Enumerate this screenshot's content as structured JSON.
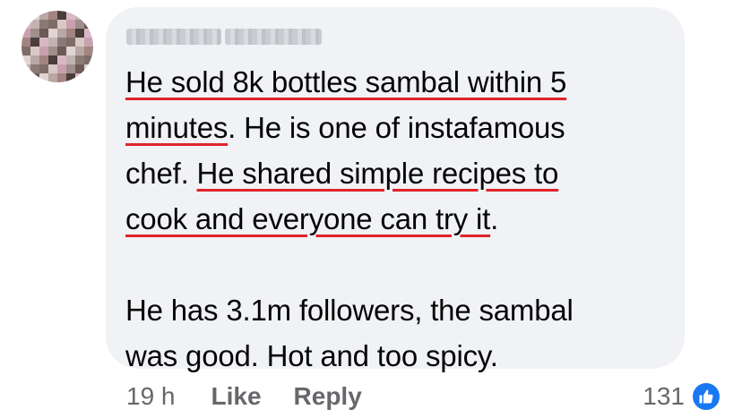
{
  "comment": {
    "author": "",
    "lines": [
      {
        "parts": [
          {
            "text": "He sold 8k bottles sambal within 5",
            "underline": true
          }
        ]
      },
      {
        "parts": [
          {
            "text": "minutes",
            "underline": true
          },
          {
            "text": ". He is one of instafamous",
            "underline": false
          }
        ]
      },
      {
        "parts": [
          {
            "text": "chef. ",
            "underline": false
          },
          {
            "text": "He shared simple recipes to",
            "underline": true
          }
        ]
      },
      {
        "parts": [
          {
            "text": "cook and everyone can try it",
            "underline": true
          },
          {
            "text": ".",
            "underline": false
          }
        ]
      },
      {
        "parts": []
      },
      {
        "parts": [
          {
            "text": "He has 3.1m followers, the sambal",
            "underline": false
          }
        ]
      },
      {
        "parts": [
          {
            "text": "was good. Hot and too spicy.",
            "underline": false
          }
        ]
      }
    ]
  },
  "meta": {
    "time": "19 h",
    "like_label": "Like",
    "reply_label": "Reply"
  },
  "reactions": {
    "count": "131",
    "icon": "thumbs-up-icon",
    "badge_color": "#1877f2"
  },
  "colors": {
    "bubble": "#f0f2f5",
    "underline": "#e0242a",
    "meta_text": "#65676b"
  }
}
